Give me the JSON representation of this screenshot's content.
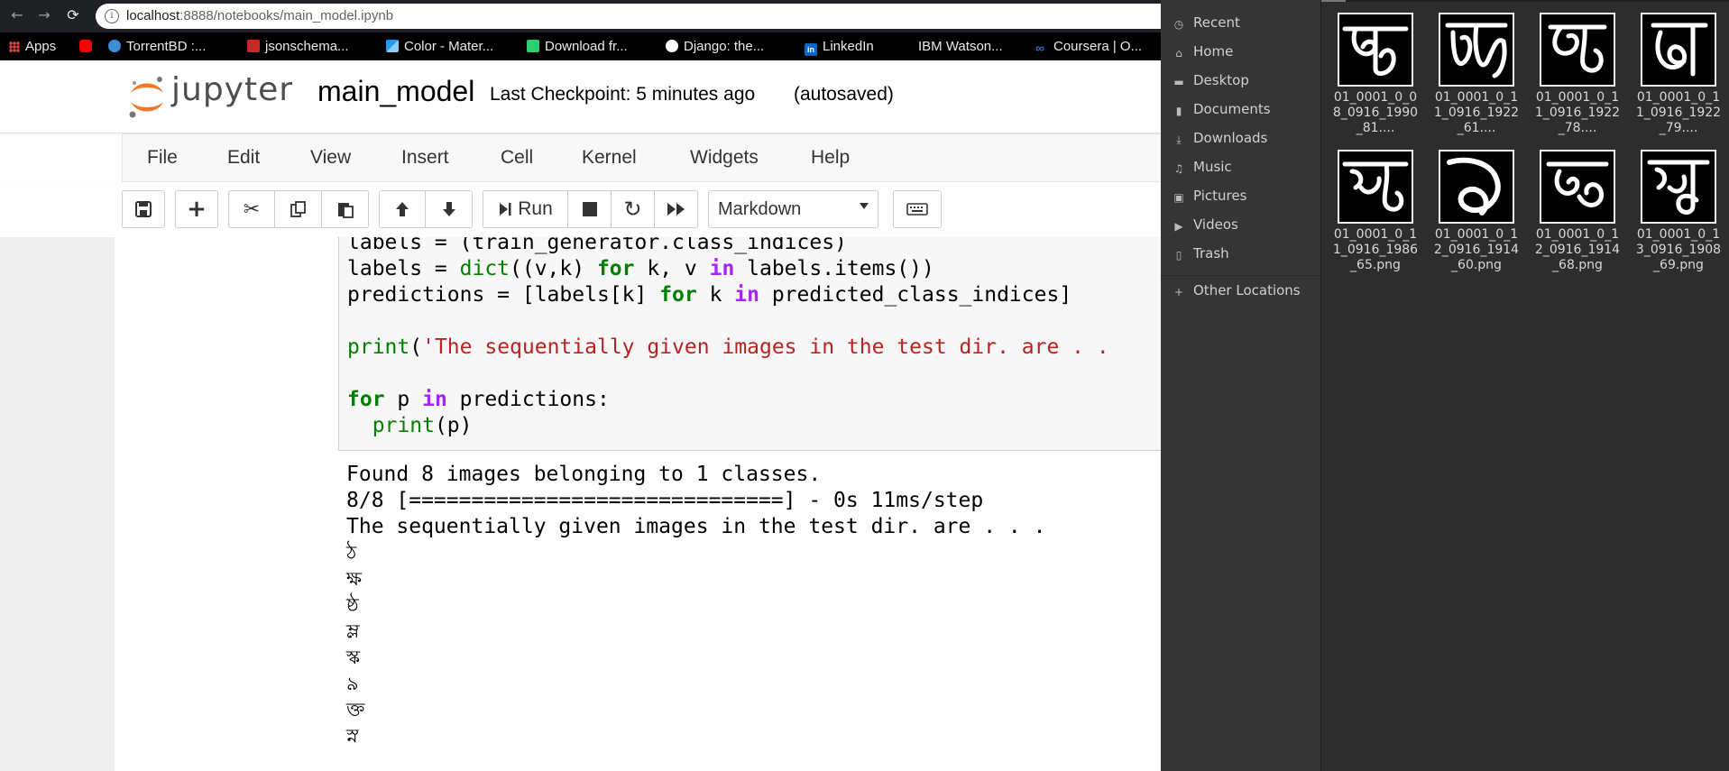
{
  "browser": {
    "url_host": "localhost",
    "url_rest": ":8888/notebooks/main_model.ipynb",
    "bookmarks": [
      {
        "label": "Apps",
        "icon": "apps-grid-icon",
        "color": "#e8453c"
      },
      {
        "label": "",
        "icon": "youtube-icon",
        "color": "#ff0000"
      },
      {
        "label": "TorrentBD :...",
        "icon": "torrentbd-icon",
        "color": "#3a8fd6"
      },
      {
        "label": "jsonschema...",
        "icon": "dojo-icon",
        "color": "#c62828"
      },
      {
        "label": "Color - Mater...",
        "icon": "material-icon",
        "color": "#2196f3"
      },
      {
        "label": "Download fr...",
        "icon": "download-site-icon",
        "color": "#2ecc71"
      },
      {
        "label": "Django: the...",
        "icon": "globe-icon",
        "color": "#ffffff"
      },
      {
        "label": "LinkedIn",
        "icon": "linkedin-icon",
        "color": "#0a66c2"
      },
      {
        "label": "IBM Watson...",
        "icon": "ibm-icon",
        "color": "#000000"
      },
      {
        "label": "Coursera | O...",
        "icon": "coursera-icon",
        "color": "#2a73cc"
      }
    ]
  },
  "jupyter": {
    "logo_text": "jupyter",
    "notebook_name": "main_model",
    "checkpoint": "Last Checkpoint: 5 minutes ago",
    "autosave": "(autosaved)",
    "menu": [
      "File",
      "Edit",
      "View",
      "Insert",
      "Cell",
      "Kernel",
      "Widgets",
      "Help"
    ],
    "toolbar": {
      "run_label": "Run",
      "cell_type": "Markdown"
    }
  },
  "cell": {
    "code_lines": [
      "labels = (train_generator.class_indices)",
      "labels = dict((v,k) for k, v in labels.items())",
      "predictions = [labels[k] for k in predicted_class_indices]",
      "",
      "print('The sequentially given images in the test dir. are . .",
      "",
      "for p in predictions:",
      "  print(p)"
    ],
    "output_lines": [
      "Found 8 images belonging to 1 classes.",
      "8/8 [==============================] - 0s 11ms/step",
      "The sequentially given images in the test dir. are . . ."
    ],
    "predictions": [
      "ঠ",
      "ক্ষ",
      "ষ্ঠ",
      "ম্ল",
      "স্ক",
      "৯",
      "ক্ত",
      "স্ন"
    ]
  },
  "file_manager": {
    "sidebar": [
      {
        "label": "Recent",
        "icon": "clock-icon"
      },
      {
        "label": "Home",
        "icon": "home-icon"
      },
      {
        "label": "Desktop",
        "icon": "desktop-icon"
      },
      {
        "label": "Documents",
        "icon": "document-icon"
      },
      {
        "label": "Downloads",
        "icon": "download-icon"
      },
      {
        "label": "Music",
        "icon": "music-icon"
      },
      {
        "label": "Pictures",
        "icon": "pictures-icon"
      },
      {
        "label": "Videos",
        "icon": "video-icon"
      },
      {
        "label": "Trash",
        "icon": "trash-icon"
      },
      {
        "label": "Other Locations",
        "icon": "plus-icon"
      }
    ],
    "files": [
      {
        "name": "01_0001_0_08_0916_1990_81...."
      },
      {
        "name": "01_0001_0_11_0916_1922_61...."
      },
      {
        "name": "01_0001_0_11_0916_1922_78...."
      },
      {
        "name": "01_0001_0_11_0916_1922_79...."
      },
      {
        "name": "01_0001_0_11_0916_1986_65.png"
      },
      {
        "name": "01_0001_0_12_0916_1914_60.png"
      },
      {
        "name": "01_0001_0_12_0916_1914_68.png"
      },
      {
        "name": "01_0001_0_13_0916_1908_69.png"
      }
    ]
  }
}
